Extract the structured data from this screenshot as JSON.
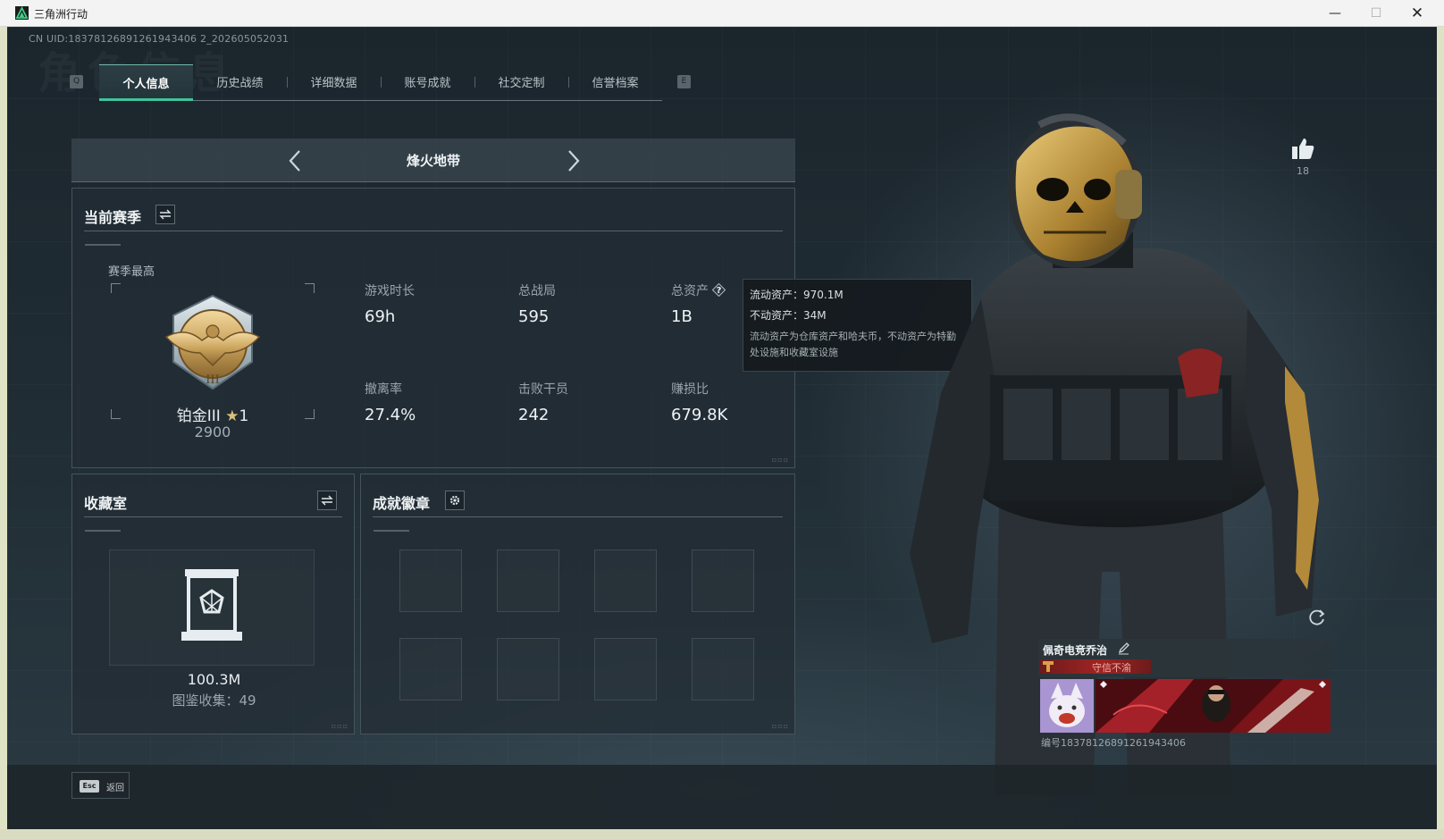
{
  "window": {
    "title": "三角洲行动",
    "min_glyph": "—",
    "max_glyph": "☐",
    "close_glyph": "✕"
  },
  "header": {
    "uid_text": "CN UID:18378126891261943406 2_202605052031",
    "ghost_title": "角色信息"
  },
  "tabs": {
    "items": [
      {
        "label": "个人信息",
        "active": true
      },
      {
        "label": "历史战绩"
      },
      {
        "label": "详细数据"
      },
      {
        "label": "账号成就"
      },
      {
        "label": "社交定制"
      },
      {
        "label": "信誉档案"
      }
    ],
    "prev_key": "Q",
    "next_key": "E"
  },
  "mode": {
    "title": "烽火地带",
    "prev_icon": "chevron-left-icon",
    "next_icon": "chevron-right-icon"
  },
  "season": {
    "title": "当前赛季",
    "best_label": "赛季最高",
    "rank_name": "铂金III",
    "rank_star": "★",
    "rank_stars": "1",
    "rank_score": "2900",
    "stats": [
      {
        "label": "游戏时长",
        "value": "69h"
      },
      {
        "label": "总战局",
        "value": "595"
      },
      {
        "label": "总资产",
        "value": "1B"
      },
      {
        "label": "撤离率",
        "value": "27.4%"
      },
      {
        "label": "击败干员",
        "value": "242"
      },
      {
        "label": "赚损比",
        "value": "679.8K"
      }
    ]
  },
  "asset_tooltip": {
    "liquid": "流动资产：970.1M",
    "fixed": "不动资产：34M",
    "description": "流动资产为仓库资产和哈夫币，不动资产为特勤处设施和收藏室设施"
  },
  "collection": {
    "title": "收藏室",
    "value": "100.3M",
    "count_text": "图鉴收集：49"
  },
  "badges": {
    "title": "成就徽章",
    "slot_count": 8
  },
  "likes": {
    "count": "18"
  },
  "player": {
    "name": "佩奇电竞乔治",
    "title_badge": "守信不渝",
    "id_text": "编号18378126891261943406"
  },
  "bottom": {
    "esc_key": "Esc",
    "back_label": "返回"
  },
  "colors": {
    "accent": "#3fc49b",
    "badge_red": "#a12424",
    "gold": "#c9a25a"
  }
}
